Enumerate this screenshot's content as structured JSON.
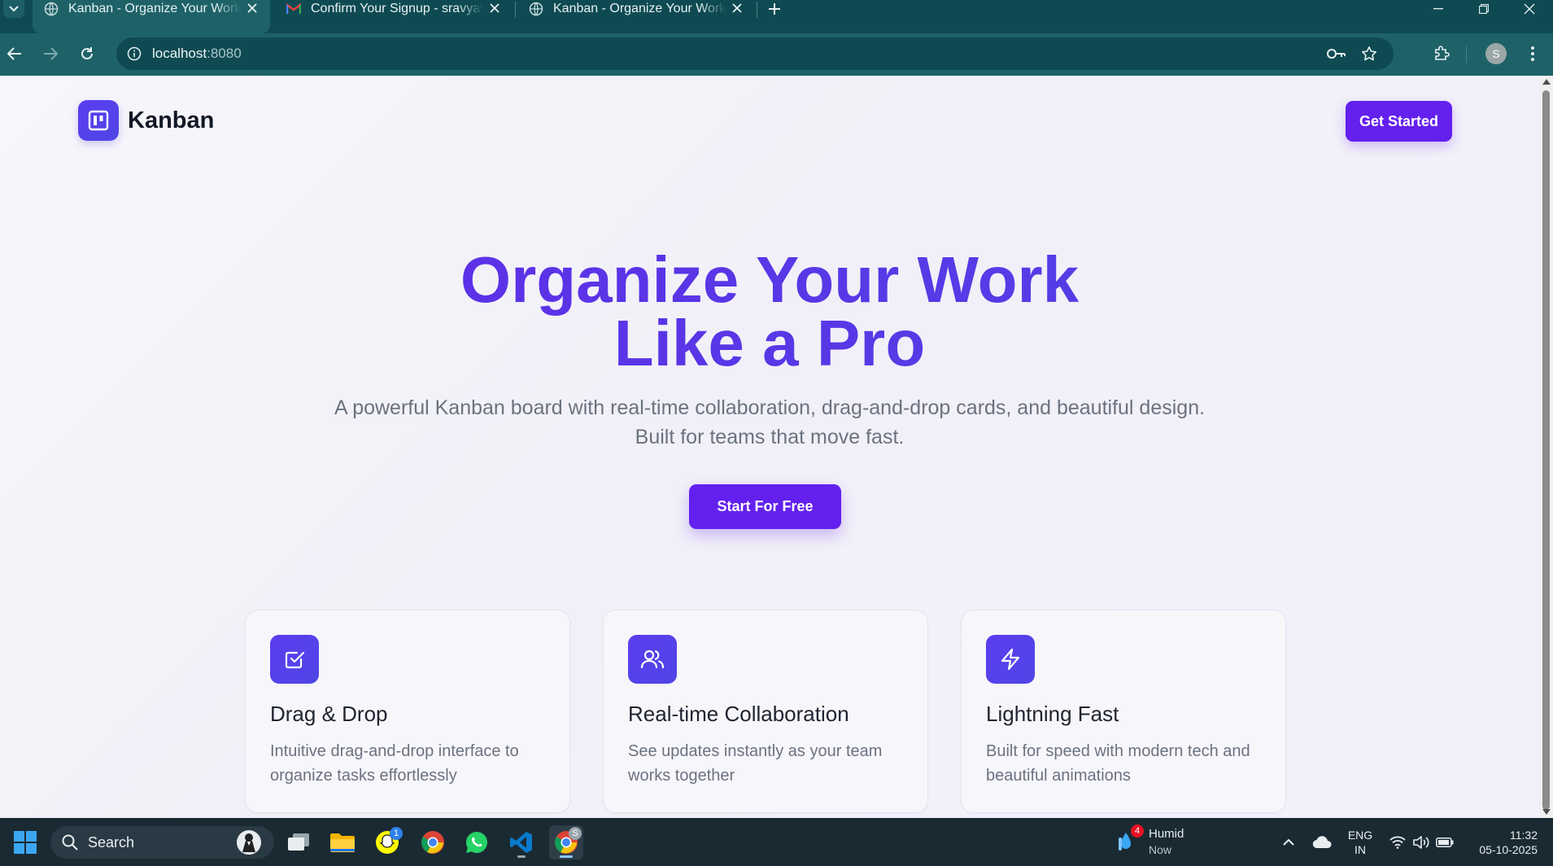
{
  "browser": {
    "tabs": [
      {
        "title": "Kanban - Organize Your Work Like a Pro",
        "active": true
      },
      {
        "title": "Confirm Your Signup - sravyaveeramallu@gmail.com",
        "active": false
      },
      {
        "title": "Kanban - Organize Your Work Like a Pro",
        "active": false
      }
    ],
    "url_host": "localhost",
    "url_port": ":8080",
    "profile_initial": "S"
  },
  "page": {
    "logo_text": "Kanban",
    "nav_cta": "Get Started",
    "hero_title_line1": "Organize Your Work",
    "hero_title_line2": "Like a Pro",
    "hero_sub_line1": "A powerful Kanban board with real-time collaboration, drag-and-drop cards, and beautiful design.",
    "hero_sub_line2": "Built for teams that move fast.",
    "hero_cta": "Start For Free",
    "features": [
      {
        "icon": "checkbox-icon",
        "title": "Drag & Drop",
        "desc": "Intuitive drag-and-drop interface to organize tasks effortlessly"
      },
      {
        "icon": "users-icon",
        "title": "Real-time Collaboration",
        "desc": "See updates instantly as your team works together"
      },
      {
        "icon": "lightning-icon",
        "title": "Lightning Fast",
        "desc": "Built for speed with modern tech and beautiful animations"
      }
    ]
  },
  "taskbar": {
    "search_placeholder": "Search",
    "weather_title": "Humid",
    "weather_sub": "Now",
    "weather_badge": "4",
    "snapchat_badge": "1",
    "chrome_profile_badge": "S",
    "lang_line1": "ENG",
    "lang_line2": "IN",
    "time": "11:32",
    "date": "05-10-2025"
  },
  "colors": {
    "brand": "#6320ee",
    "brand_gradient_end": "#4f46e5",
    "browser_frame": "#1e6268",
    "taskbar": "#1a2a33"
  }
}
